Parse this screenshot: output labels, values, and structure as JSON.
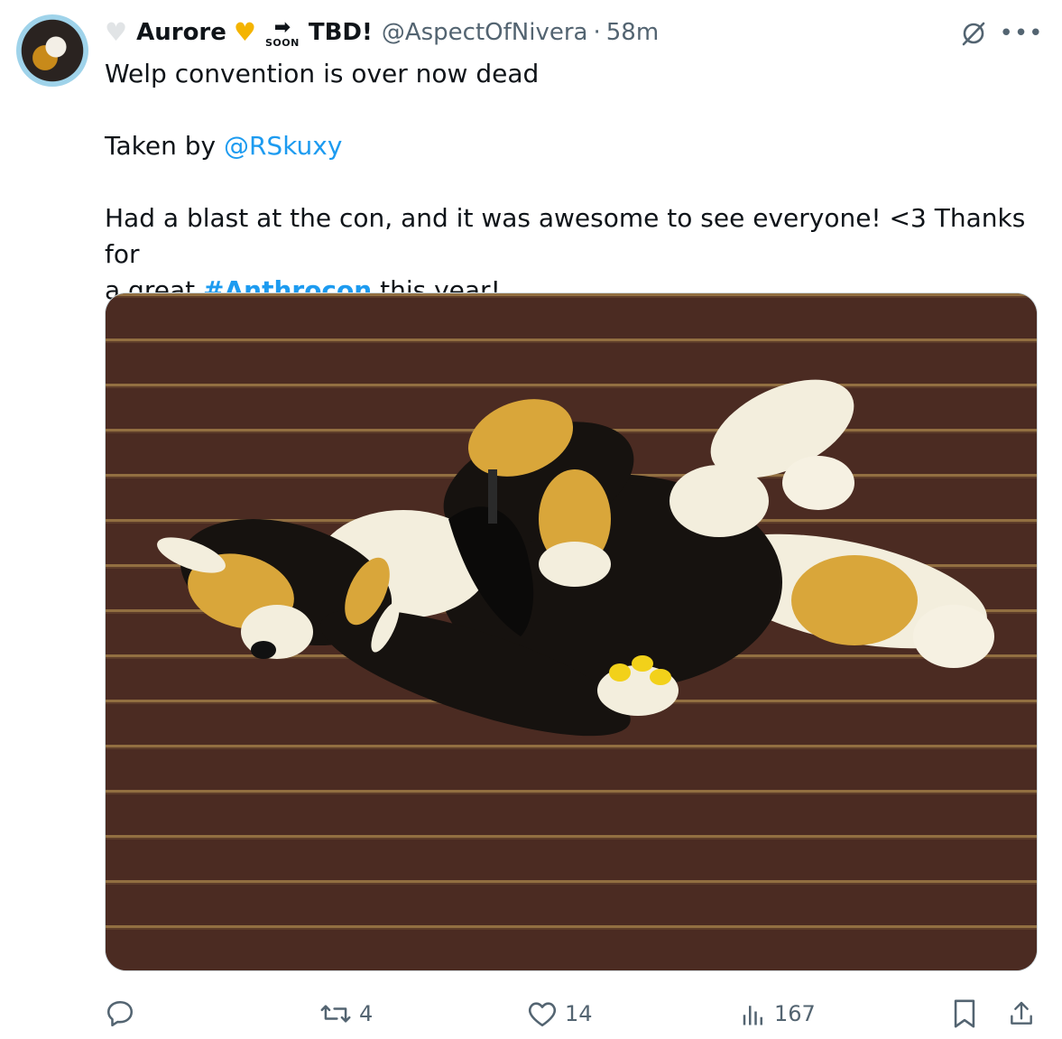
{
  "author": {
    "name": "Aurore",
    "badge_text": "SOON",
    "name_suffix": "TBD!",
    "handle": "@AspectOfNivera",
    "separator": "·",
    "time": "58m"
  },
  "tweet": {
    "line1": "Welp convention is over now dead",
    "line2_prefix": "Taken by ",
    "line2_mention": "@RSkuxy",
    "line3": "Had a blast at the con, and it was awesome to see everyone! <3 Thanks for",
    "line4_prefix": "a great ",
    "line4_hashtag": "#Anthrocon",
    "line4_suffix": " this year!"
  },
  "actions": {
    "retweets": "4",
    "likes": "14",
    "views": "167"
  },
  "icons": [
    "white-heart-icon",
    "gold-heart-icon",
    "soon-arrow-icon",
    "grok-icon",
    "more-icon",
    "reply-icon",
    "retweet-icon",
    "like-icon",
    "views-icon",
    "bookmark-icon",
    "share-icon"
  ],
  "colors": {
    "link": "#1d9bf0",
    "muted": "#536471",
    "text": "#0f1419",
    "carpet": "#4b2b22",
    "carpet_stripe": "#b08a4a"
  }
}
